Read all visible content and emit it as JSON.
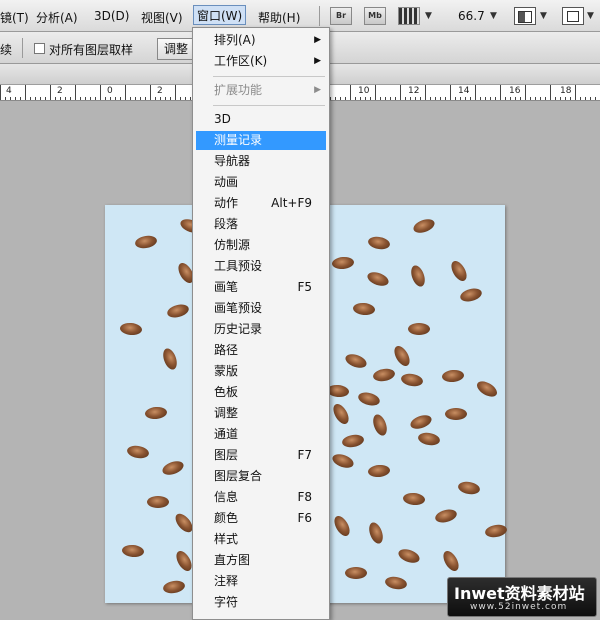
{
  "menubar": {
    "items": [
      "镜(T)",
      "分析(A)",
      "3D(D)",
      "视图(V)",
      "窗口(W)",
      "帮助(H)"
    ],
    "bridge_label": "Br",
    "minibridge_label": "Mb",
    "zoom": "66.7"
  },
  "options": {
    "text_partial": "续",
    "sample_all_layers": "对所有图层取样",
    "sample_all_checked": false,
    "adjust_button": "调整"
  },
  "ruler": {
    "labels": [
      "4",
      "2",
      "0",
      "2",
      "4",
      "6",
      "8",
      "10",
      "12",
      "14",
      "16",
      "18"
    ]
  },
  "window_menu": {
    "items": [
      {
        "label": "排列(A)",
        "submenu": true
      },
      {
        "label": "工作区(K)",
        "submenu": true
      },
      {
        "label": "扩展功能",
        "submenu": true,
        "disabled": true
      },
      {
        "label": "3D"
      },
      {
        "label": "测量记录",
        "highlighted": true
      },
      {
        "label": "导航器"
      },
      {
        "label": "动画"
      },
      {
        "label": "动作",
        "shortcut": "Alt+F9"
      },
      {
        "label": "段落"
      },
      {
        "label": "仿制源"
      },
      {
        "label": "工具预设"
      },
      {
        "label": "画笔",
        "shortcut": "F5"
      },
      {
        "label": "画笔预设"
      },
      {
        "label": "历史记录"
      },
      {
        "label": "路径"
      },
      {
        "label": "蒙版"
      },
      {
        "label": "色板"
      },
      {
        "label": "调整"
      },
      {
        "label": "通道"
      },
      {
        "label": "图层",
        "shortcut": "F7"
      },
      {
        "label": "图层复合"
      },
      {
        "label": "信息",
        "shortcut": "F8"
      },
      {
        "label": "颜色",
        "shortcut": "F6"
      },
      {
        "label": "样式"
      },
      {
        "label": "直方图"
      },
      {
        "label": "注释"
      },
      {
        "label": "字符"
      }
    ]
  },
  "watermark": {
    "title": "Inwet资料素材站",
    "url": "www.52inwet.com"
  },
  "colors": {
    "menu_highlight": "#3399ff",
    "canvas_bg": "#cfe7f5",
    "workspace": "#b4b4b4"
  }
}
